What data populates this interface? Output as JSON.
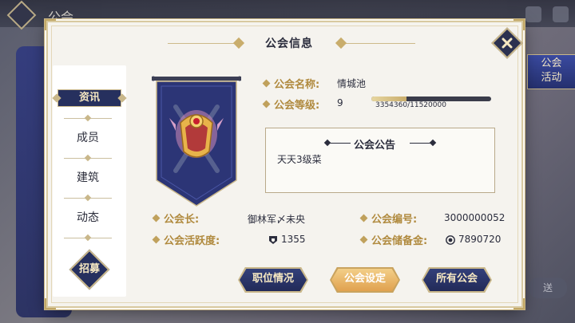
{
  "background": {
    "top_text": "公会",
    "right_banner": "公会\n活动",
    "right_button": "送"
  },
  "dialog": {
    "title": "公会信息"
  },
  "side_nav": {
    "header": "资讯",
    "items": [
      {
        "label": "成员"
      },
      {
        "label": "建筑"
      },
      {
        "label": "动态"
      }
    ],
    "recruit_label": "招募"
  },
  "guild": {
    "name_label": "公会名称:",
    "name_value": "情城池",
    "level_label": "公会等级:",
    "level_value": "9",
    "exp_text": "3354360/11520000",
    "exp_fraction": 0.291,
    "leader_label": "公会长:",
    "leader_value": "御林军〆未央",
    "activity_label": "公会活跃度:",
    "activity_value": "1355",
    "id_label": "公会编号:",
    "id_value": "3000000052",
    "fund_label": "公会储备金:",
    "fund_value": "7890720"
  },
  "notice": {
    "title": "公会公告",
    "content": "天天3级菜"
  },
  "buttons": {
    "positions": "职位情况",
    "settings": "公会设定",
    "all_guilds": "所有公会"
  },
  "colors": {
    "accent_gold": "#c9b78a",
    "navy": "#26305e",
    "label_gold": "#b08a3e",
    "button_orange": "#e0a14f"
  }
}
